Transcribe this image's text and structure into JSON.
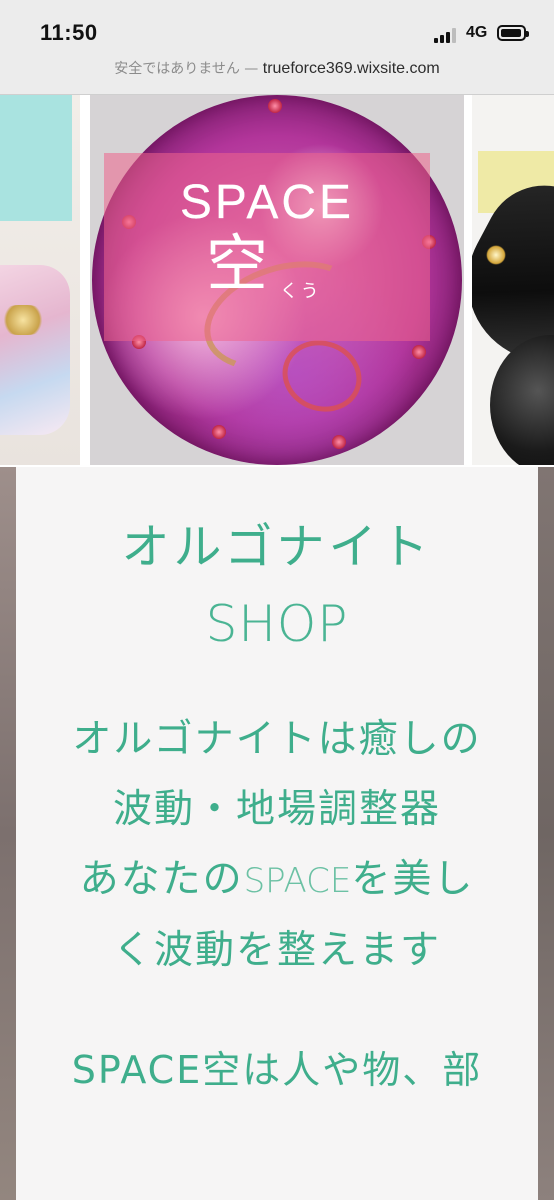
{
  "status_bar": {
    "time": "11:50",
    "network": "4G"
  },
  "address_bar": {
    "security_text": "安全ではありません —",
    "host": "trueforce369.wixsite.com"
  },
  "hero": {
    "space_label": "SPACE",
    "kanji": "空",
    "ruby": "くう"
  },
  "content": {
    "title": "オルゴナイト",
    "subtitle": "SHOP",
    "lines": [
      "オルゴナイトは癒しの",
      "波動・地場調整器",
      "あなたの",
      "SPACE",
      "を美し",
      "く波動を整えます"
    ],
    "teaser": "SPACE空は人や物、部"
  },
  "colors": {
    "accent": "#3fae8c",
    "overlay_pink": "#ee648c",
    "panel_bg": "#f6f5f5"
  }
}
